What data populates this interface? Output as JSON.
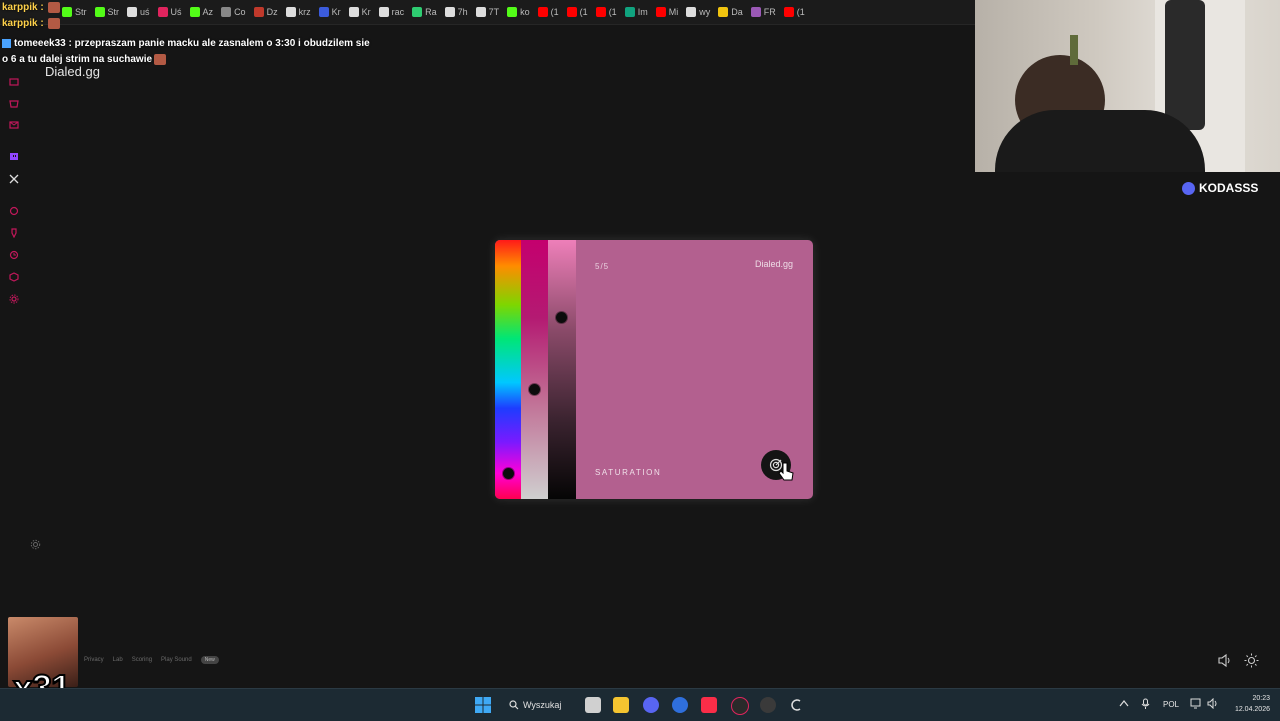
{
  "browser": {
    "tabs": [
      {
        "label": "Str",
        "color": "#53fc18"
      },
      {
        "label": "Str",
        "color": "#53fc18"
      },
      {
        "label": "uś",
        "color": "#dddddd"
      },
      {
        "label": "Uś",
        "color": "#e0245e"
      },
      {
        "label": "Az",
        "color": "#53fc18"
      },
      {
        "label": "Co",
        "color": "#888888"
      },
      {
        "label": "Dz",
        "color": "#c0392b"
      },
      {
        "label": "krz",
        "color": "#dddddd"
      },
      {
        "label": "Kr",
        "color": "#3b5bdb"
      },
      {
        "label": "Kr",
        "color": "#dddddd"
      },
      {
        "label": "rac",
        "color": "#dddddd"
      },
      {
        "label": "Ra",
        "color": "#2ecc71"
      },
      {
        "label": "7h",
        "color": "#dddddd"
      },
      {
        "label": "7T",
        "color": "#dddddd"
      },
      {
        "label": "ko",
        "color": "#53fc18"
      },
      {
        "label": "(1",
        "color": "#ff0000"
      },
      {
        "label": "(1",
        "color": "#ff0000"
      },
      {
        "label": "(1",
        "color": "#ff0000"
      },
      {
        "label": "Im",
        "color": "#10a37f"
      },
      {
        "label": "Mi",
        "color": "#ff0000"
      },
      {
        "label": "wy",
        "color": "#dddddd"
      },
      {
        "label": "Da",
        "color": "#f1c40f"
      },
      {
        "label": "FR",
        "color": "#9b59b6"
      },
      {
        "label": "(1",
        "color": "#ff0000"
      }
    ]
  },
  "chat": {
    "messages": [
      {
        "user": "karppik",
        "text": ""
      },
      {
        "user": "karppik",
        "text": ""
      },
      {
        "user": "tomeeek33",
        "text": "przepraszam panie macku ale zasnalem o 3:30 i obudzilem sie"
      },
      {
        "user": "",
        "text": "o 6 a tu dalej strim na suchawie"
      }
    ]
  },
  "site": {
    "title": "Dialed.gg"
  },
  "card": {
    "step": "5/5",
    "brand": "Dialed.gg",
    "parameter": "SATURATION",
    "color": "#b3608f",
    "hue_level": 0.92,
    "saturation_level": 0.58,
    "brightness_level": 0.29
  },
  "footer": {
    "links": [
      "Privacy",
      "Lab",
      "Scoring",
      "Play Sound"
    ],
    "new_badge": "New"
  },
  "stream": {
    "streamer": "KODASSS",
    "counter": "x31"
  },
  "taskbar": {
    "search_label": "Wyszukaj",
    "language": "POL",
    "time": "20:23",
    "date": "12.04.2026"
  }
}
